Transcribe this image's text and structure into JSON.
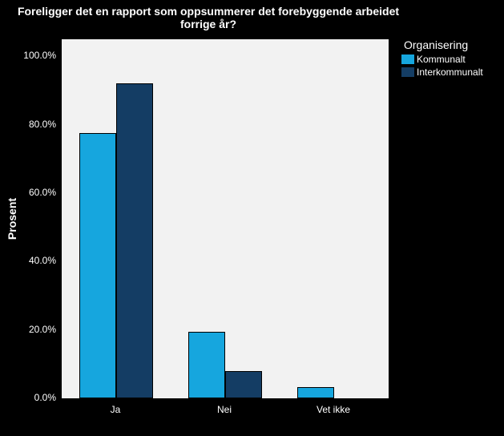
{
  "chart_data": {
    "type": "bar",
    "title": "Foreligger det en rapport som oppsummerer det forebyggende arbeidet forrige år?",
    "xlabel": "",
    "ylabel": "Prosent",
    "ylim": [
      0,
      105
    ],
    "y_ticks": [
      0,
      20,
      40,
      60,
      80,
      100
    ],
    "y_tick_labels": [
      "0.0%",
      "20.0%",
      "40.0%",
      "60.0%",
      "80.0%",
      "100.0%"
    ],
    "categories": [
      "Ja",
      "Nei",
      "Vet ikke"
    ],
    "series": [
      {
        "name": "Kommunalt",
        "color": "#16a6de",
        "values": [
          77.5,
          19.5,
          3.2
        ]
      },
      {
        "name": "Interkommunalt",
        "color": "#143d64",
        "values": [
          92,
          8,
          0
        ]
      }
    ],
    "legend_title": "Organisering"
  }
}
